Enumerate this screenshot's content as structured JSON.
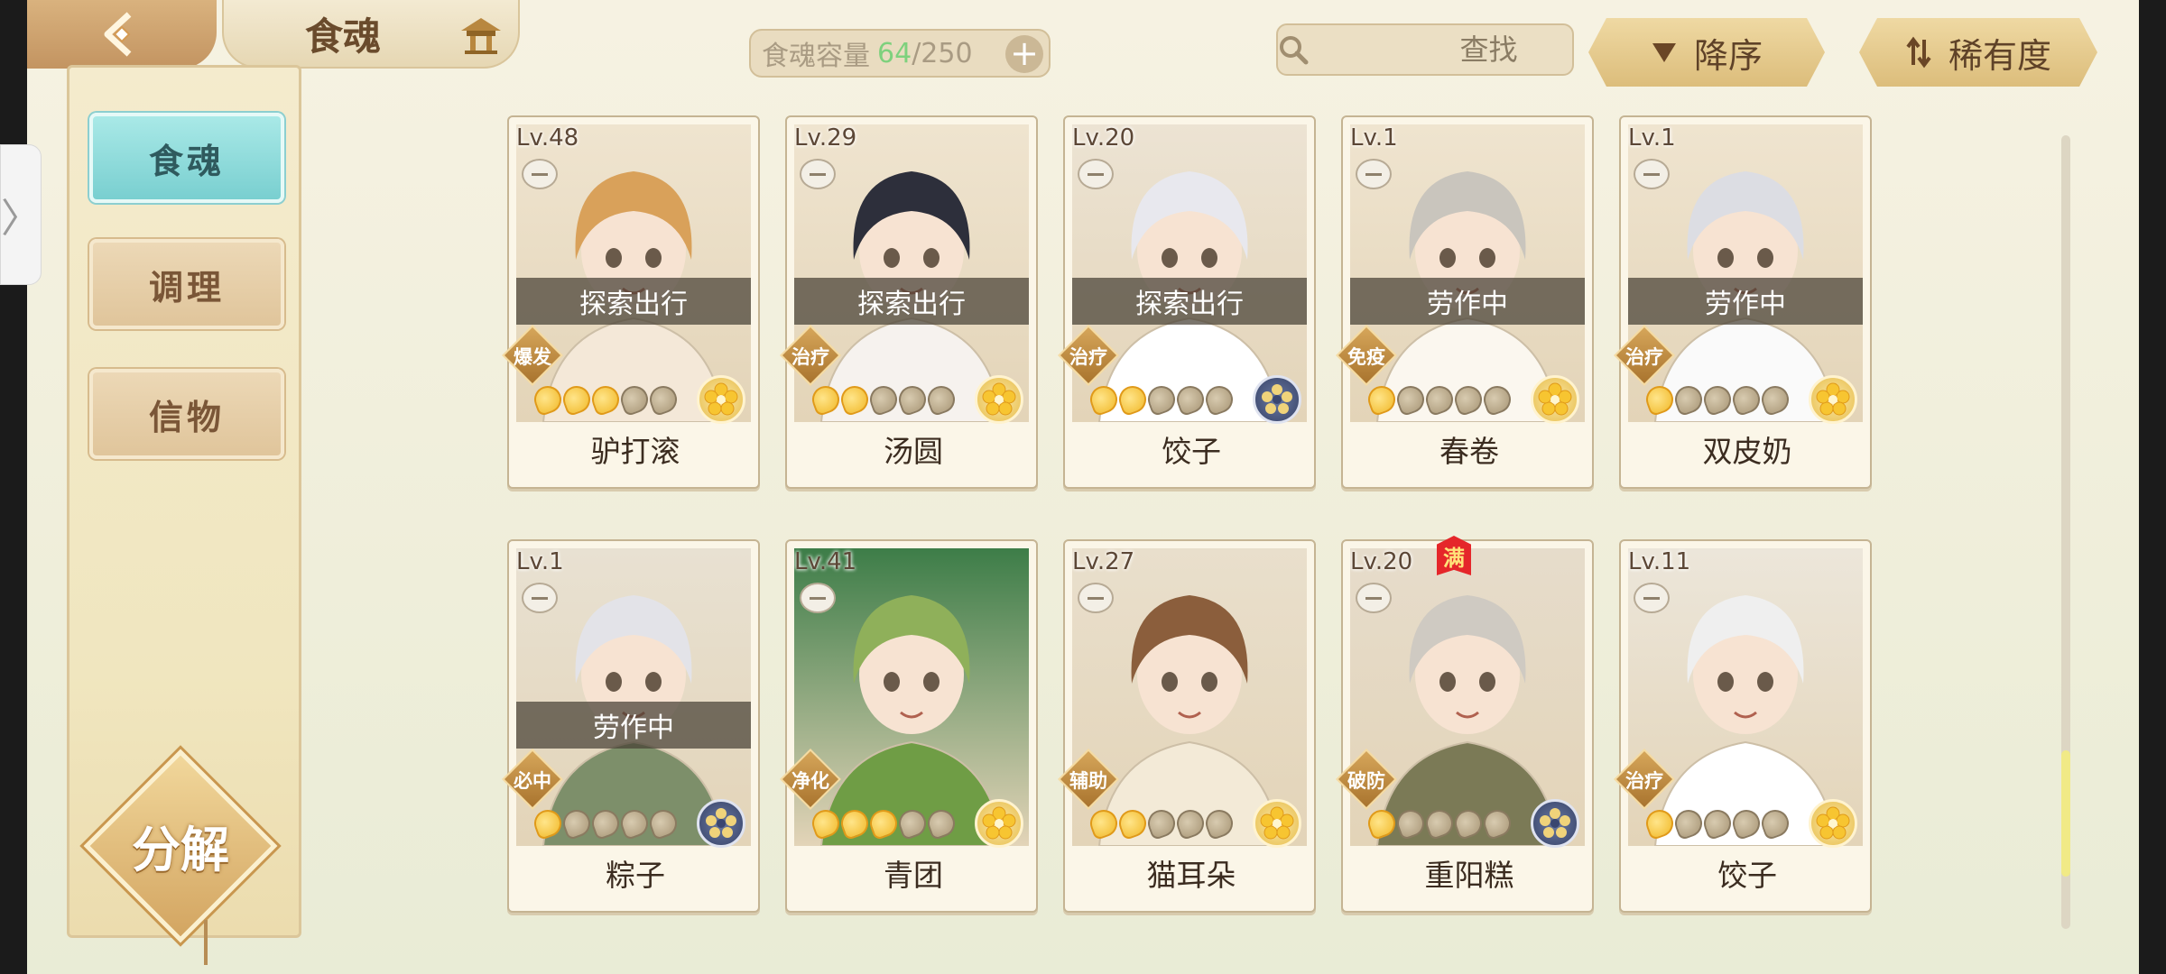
{
  "header": {
    "title": "食魂",
    "capacity_label": "食魂容量",
    "capacity_current": "64",
    "capacity_max": "/250",
    "capacity_plus": "+",
    "search_placeholder": "查找",
    "clear": "✕",
    "sort_order": "降序",
    "sort_key": "稀有度"
  },
  "sidebar": {
    "items": [
      {
        "label": "食魂",
        "active": true
      },
      {
        "label": "调理",
        "active": false
      },
      {
        "label": "信物",
        "active": false
      }
    ],
    "decompose_label": "分解"
  },
  "cards": [
    {
      "level": "Lv.48",
      "name": "驴打滚",
      "status": "探索出行",
      "role": "爆发",
      "stars": 3,
      "element": "gold",
      "max": false
    },
    {
      "level": "Lv.29",
      "name": "汤圆",
      "status": "探索出行",
      "role": "治疗",
      "stars": 2,
      "element": "gold",
      "max": false
    },
    {
      "level": "Lv.20",
      "name": "饺子",
      "status": "探索出行",
      "role": "治疗",
      "stars": 2,
      "element": "dark",
      "max": false
    },
    {
      "level": "Lv.1",
      "name": "春卷",
      "status": "劳作中",
      "role": "免疫",
      "stars": 1,
      "element": "gold",
      "max": false
    },
    {
      "level": "Lv.1",
      "name": "双皮奶",
      "status": "劳作中",
      "role": "治疗",
      "stars": 1,
      "element": "gold",
      "max": false
    },
    {
      "level": "Lv.1",
      "name": "粽子",
      "status": "劳作中",
      "role": "必中",
      "stars": 1,
      "element": "dark",
      "max": false
    },
    {
      "level": "Lv.41",
      "name": "青团",
      "status": "",
      "role": "净化",
      "stars": 3,
      "element": "gold",
      "max": false
    },
    {
      "level": "Lv.27",
      "name": "猫耳朵",
      "status": "",
      "role": "辅助",
      "stars": 2,
      "element": "gold",
      "max": false
    },
    {
      "level": "Lv.20",
      "name": "重阳糕",
      "status": "",
      "role": "破防",
      "stars": 1,
      "element": "dark",
      "max": true,
      "max_label": "满"
    },
    {
      "level": "Lv.11",
      "name": "饺子",
      "status": "",
      "role": "治疗",
      "stars": 1,
      "element": "gold",
      "max": false
    }
  ],
  "colors": {
    "accent_teal": "#79cfd0",
    "gold": "#dcbd7b",
    "capacity_green": "#7ed17d"
  }
}
